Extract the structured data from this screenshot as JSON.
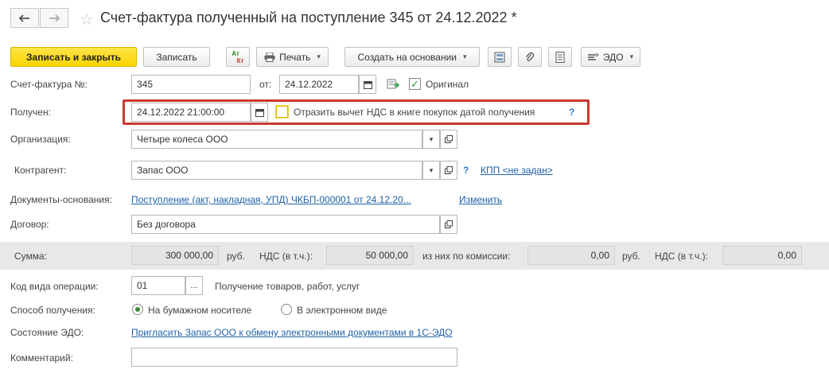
{
  "header": {
    "title": "Счет-фактура полученный на поступление 345 от 24.12.2022 *"
  },
  "toolbar": {
    "save_close": "Записать и закрыть",
    "save": "Записать",
    "dtkt_top": "Ат",
    "dtkt_bottom": "Кт",
    "print": "Печать",
    "create_based": "Создать на основании",
    "edo": "ЭДО"
  },
  "form": {
    "invoice_no_label": "Счет-фактура №:",
    "invoice_no": "345",
    "from_label": "от:",
    "invoice_date": "24.12.2022",
    "original_label": "Оригинал",
    "received_label": "Получен:",
    "received_value": "24.12.2022 21:00:00",
    "vat_deduction_label": "Отразить вычет НДС в книге покупок датой получения",
    "help": "?",
    "org_label": "Организация:",
    "org_value": "Четыре колеса ООО",
    "contractor_label": "Контрагент:",
    "contractor_value": "Запас ООО",
    "kpp_link": "КПП <не задан>",
    "base_docs_label": "Документы-основания:",
    "base_docs_link": "Поступление (акт, накладная, УПД) ЧКБП-000001 от 24.12.20...",
    "change_link": "Изменить",
    "contract_label": "Договор:",
    "contract_value": "Без договора",
    "op_code_label": "Код вида операции:",
    "op_code_value": "01",
    "op_code_btn": "...",
    "op_code_desc": "Получение товаров, работ, услуг",
    "receive_method_label": "Способ получения:",
    "paper_label": "На бумажном носителе",
    "electronic_label": "В электронном виде",
    "edo_state_label": "Состояние ЭДО:",
    "edo_link": "Пригласить Запас ООО к обмену электронными документами в 1С-ЭДО",
    "comment_label": "Комментарий:",
    "comment_value": ""
  },
  "sums": {
    "sum_label": "Сумма:",
    "sum_value": "300 000,00",
    "rub1": "руб.",
    "vat_label1": "НДС (в т.ч.):",
    "vat_value1": "50 000,00",
    "commission_label": "из них по комиссии:",
    "commission_value": "0,00",
    "rub2": "руб.",
    "vat_label2": "НДС (в т.ч.):",
    "vat_value2": "0,00"
  },
  "state": {
    "original_checked": true,
    "vat_deduction_checked": false,
    "receive_method": "paper"
  }
}
